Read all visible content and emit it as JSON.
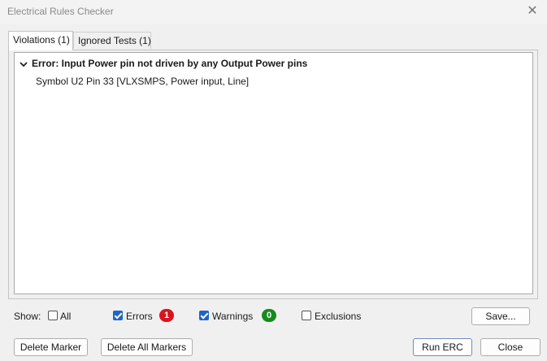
{
  "window": {
    "title": "Electrical Rules Checker",
    "close_glyph": "✕"
  },
  "tabs": [
    {
      "label": "Violations (1)",
      "active": true
    },
    {
      "label": "Ignored Tests (1)",
      "active": false
    }
  ],
  "violations": [
    {
      "text": "Error: Input Power pin not driven by any Output Power pins",
      "expanded": true,
      "items": [
        "Symbol U2 Pin 33 [VLXSMPS, Power input, Line]"
      ]
    }
  ],
  "filters": {
    "show_label": "Show:",
    "all": {
      "label": "All",
      "checked": false
    },
    "errors": {
      "label": "Errors",
      "checked": true,
      "count": "1",
      "color": "#d9141e"
    },
    "warnings": {
      "label": "Warnings",
      "checked": true,
      "count": "0",
      "color": "#178a1e"
    },
    "exclusions": {
      "label": "Exclusions",
      "checked": false
    }
  },
  "buttons": {
    "save": "Save...",
    "delete_marker": "Delete Marker",
    "delete_all_markers": "Delete All Markers",
    "run_erc": "Run ERC",
    "close": "Close"
  },
  "icons": {
    "expand": "chevron-down-icon",
    "close": "close-icon"
  }
}
